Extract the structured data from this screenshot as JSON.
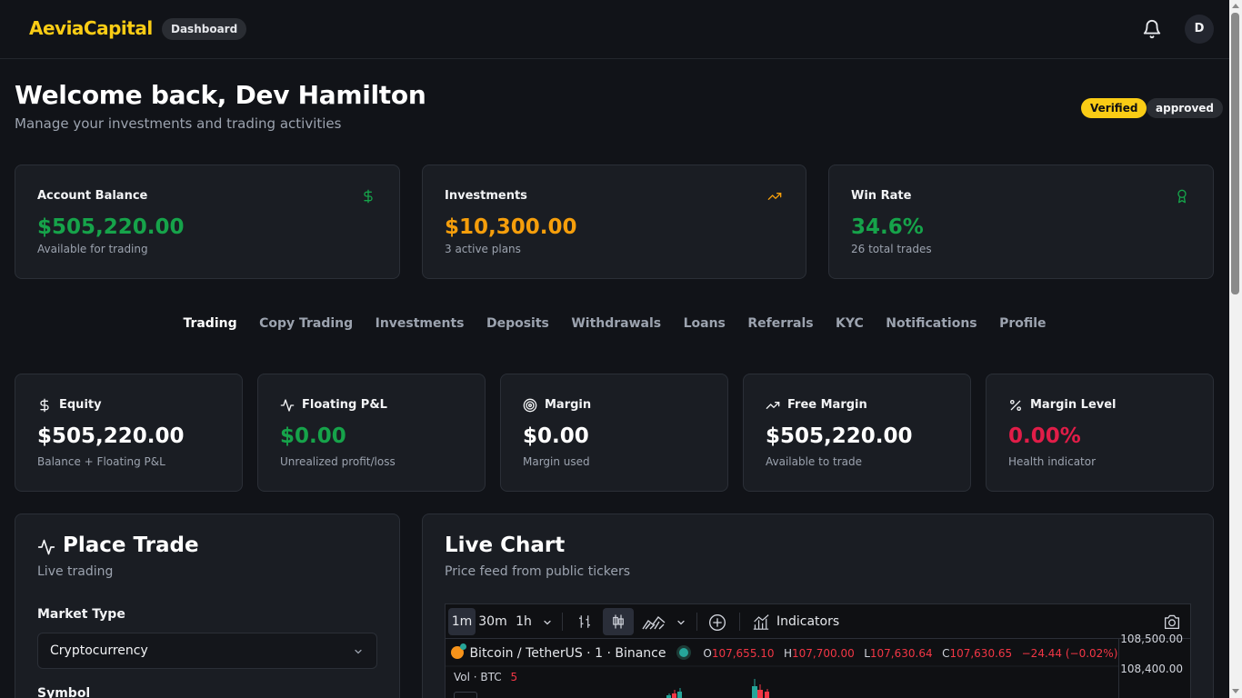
{
  "header": {
    "logo": "AeviaCapital",
    "page_badge": "Dashboard",
    "avatar_initial": "D"
  },
  "welcome": {
    "title": "Welcome back, Dev Hamilton",
    "subtitle": "Manage your investments and trading activities",
    "badges": [
      "Verified",
      "approved"
    ]
  },
  "summary_cards": [
    {
      "title": "Account Balance",
      "value": "$505,220.00",
      "sub": "Available for trading",
      "icon": "dollar-icon",
      "color": "#16a34a"
    },
    {
      "title": "Investments",
      "value": "$10,300.00",
      "sub": "3 active plans",
      "icon": "trending-up-icon",
      "color": "#f59e0b"
    },
    {
      "title": "Win Rate",
      "value": "34.6%",
      "sub": "26 total trades",
      "icon": "award-icon",
      "color": "#16a34a"
    }
  ],
  "tabs": [
    "Trading",
    "Copy Trading",
    "Investments",
    "Deposits",
    "Withdrawals",
    "Loans",
    "Referrals",
    "KYC",
    "Notifications",
    "Profile"
  ],
  "active_tab": "Trading",
  "stats": [
    {
      "title": "Equity",
      "value": "$505,220.00",
      "sub": "Balance + Floating P&L",
      "icon": "dollar-icon"
    },
    {
      "title": "Floating P&L",
      "value": "$0.00",
      "sub": "Unrealized profit/loss",
      "icon": "activity-icon",
      "color": "#16a34a"
    },
    {
      "title": "Margin",
      "value": "$0.00",
      "sub": "Margin used",
      "icon": "target-icon"
    },
    {
      "title": "Free Margin",
      "value": "$505,220.00",
      "sub": "Available to trade",
      "icon": "trending-up-icon"
    },
    {
      "title": "Margin Level",
      "value": "0.00%",
      "sub": "Health indicator",
      "icon": "percent-icon",
      "color": "#e11d48"
    }
  ],
  "place_trade": {
    "title": "Place Trade",
    "subtitle": "Live trading",
    "market_type_label": "Market Type",
    "market_type_value": "Cryptocurrency",
    "symbol_label": "Symbol"
  },
  "live_chart": {
    "title": "Live Chart",
    "subtitle": "Price feed from public tickers",
    "intervals": [
      "1m",
      "30m",
      "1h"
    ],
    "active_interval": "1m",
    "indicators_label": "Indicators",
    "symbol_line": "Bitcoin / TetherUS · 1 · Binance",
    "ohlc": {
      "o": "107,655.10",
      "h": "107,700.00",
      "l": "107,630.64",
      "c": "107,630.65",
      "change": "−24.44 (−0.02%)"
    },
    "volume_label": "Vol · BTC",
    "volume_value": "5",
    "price_labels": [
      "108,500.00",
      "108,400.00"
    ]
  }
}
